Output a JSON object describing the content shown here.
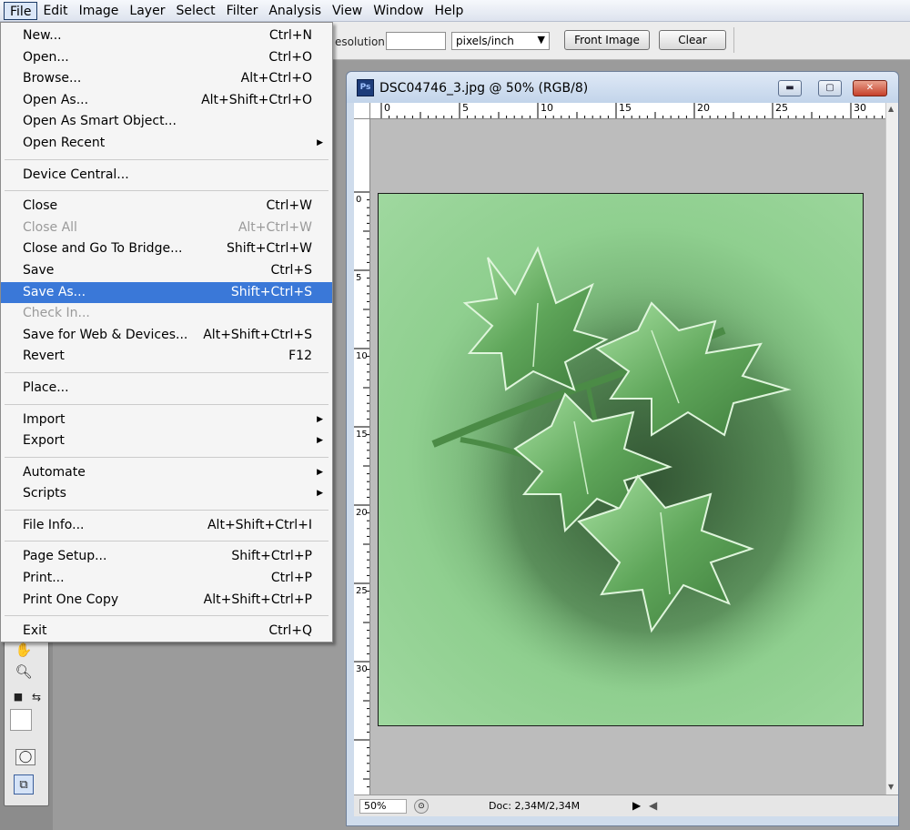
{
  "menubar": {
    "items": [
      "File",
      "Edit",
      "Image",
      "Layer",
      "Select",
      "Filter",
      "Analysis",
      "View",
      "Window",
      "Help"
    ]
  },
  "options": {
    "resolution_label": "esolution:",
    "resolution_value": "",
    "units_value": "pixels/inch",
    "front_image_label": "Front Image",
    "clear_label": "Clear"
  },
  "file_menu": {
    "items": [
      {
        "label": "New...",
        "shortcut": "Ctrl+N"
      },
      {
        "label": "Open...",
        "shortcut": "Ctrl+O"
      },
      {
        "label": "Browse...",
        "shortcut": "Alt+Ctrl+O"
      },
      {
        "label": "Open As...",
        "shortcut": "Alt+Shift+Ctrl+O"
      },
      {
        "label": "Open As Smart Object...",
        "shortcut": ""
      },
      {
        "label": "Open Recent",
        "shortcut": ""
      },
      {
        "label": "Device Central...",
        "shortcut": ""
      },
      {
        "label": "Close",
        "shortcut": "Ctrl+W"
      },
      {
        "label": "Close All",
        "shortcut": "Alt+Ctrl+W"
      },
      {
        "label": "Close and Go To Bridge...",
        "shortcut": "Shift+Ctrl+W"
      },
      {
        "label": "Save",
        "shortcut": "Ctrl+S"
      },
      {
        "label": "Save As...",
        "shortcut": "Shift+Ctrl+S"
      },
      {
        "label": "Check In...",
        "shortcut": ""
      },
      {
        "label": "Save for Web & Devices...",
        "shortcut": "Alt+Shift+Ctrl+S"
      },
      {
        "label": "Revert",
        "shortcut": "F12"
      },
      {
        "label": "Place...",
        "shortcut": ""
      },
      {
        "label": "Import",
        "shortcut": ""
      },
      {
        "label": "Export",
        "shortcut": ""
      },
      {
        "label": "Automate",
        "shortcut": ""
      },
      {
        "label": "Scripts",
        "shortcut": ""
      },
      {
        "label": "File Info...",
        "shortcut": "Alt+Shift+Ctrl+I"
      },
      {
        "label": "Page Setup...",
        "shortcut": "Shift+Ctrl+P"
      },
      {
        "label": "Print...",
        "shortcut": "Ctrl+P"
      },
      {
        "label": "Print One Copy",
        "shortcut": "Alt+Shift+Ctrl+P"
      },
      {
        "label": "Exit",
        "shortcut": "Ctrl+Q"
      }
    ],
    "highlighted": "Save As...",
    "disabled": [
      "Close All",
      "Check In..."
    ]
  },
  "document": {
    "title": "DSC04746_3.jpg @ 50% (RGB/8)",
    "ps_icon": "Ps",
    "ruler_h": [
      "0",
      "5",
      "10",
      "15",
      "20",
      "25",
      "30"
    ],
    "ruler_v": [
      "0",
      "5",
      "10",
      "15",
      "20",
      "25",
      "30"
    ],
    "zoom": "50%",
    "doc_size": "Doc: 2,34M/2,34M"
  },
  "colors": {
    "menu_highlight": "#3a78d8",
    "artwork_paper": "#9fd89f",
    "artwork_leaf": "#4f8f4a"
  }
}
